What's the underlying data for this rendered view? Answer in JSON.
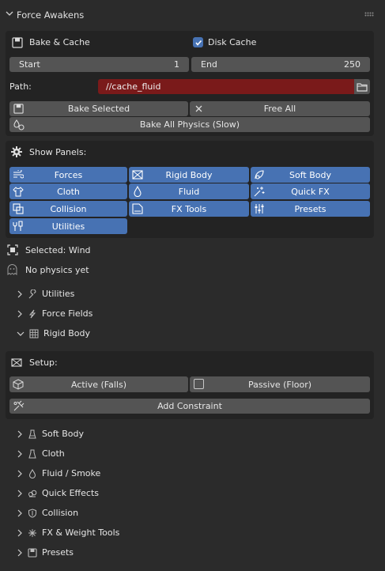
{
  "header": {
    "title": "Force Awakens"
  },
  "cache": {
    "bake_label": "Bake & Cache",
    "disk_cache_label": "Disk Cache",
    "disk_cache_checked": true,
    "start_label": "Start",
    "start_value": "1",
    "end_label": "End",
    "end_value": "250",
    "path_label": "Path:",
    "path_value": "//cache_fluid",
    "bake_selected": "Bake Selected",
    "free_all": "Free All",
    "bake_all": "Bake All Physics (Slow)"
  },
  "panels": {
    "title": "Show Panels:",
    "buttons": [
      {
        "label": "Forces",
        "icon": "wind-icon",
        "active": true
      },
      {
        "label": "Rigid Body",
        "icon": "rigid-body-icon",
        "active": true
      },
      {
        "label": "Soft Body",
        "icon": "soft-body-icon",
        "active": true
      },
      {
        "label": "Cloth",
        "icon": "cloth-icon",
        "active": true
      },
      {
        "label": "Fluid",
        "icon": "fluid-drop-icon",
        "active": true
      },
      {
        "label": "Quick FX",
        "icon": "sparkle-icon",
        "active": true
      },
      {
        "label": "Collision",
        "icon": "collision-icon",
        "active": true
      },
      {
        "label": "FX Tools",
        "icon": "fx-tools-icon",
        "active": true
      },
      {
        "label": "Presets",
        "icon": "sliders-icon",
        "active": true
      },
      {
        "label": "Utilities",
        "icon": "wrench-icon",
        "active": true
      }
    ]
  },
  "status": {
    "selected": "Selected: Wind",
    "physics": "No physics yet"
  },
  "tree": {
    "utilities": "Utilities",
    "force_fields": "Force Fields",
    "rigid_body": "Rigid Body",
    "soft_body": "Soft Body",
    "cloth": "Cloth",
    "fluid_smoke": "Fluid / Smoke",
    "quick_effects": "Quick Effects",
    "collision": "Collision",
    "fx_weight": "FX & Weight Tools",
    "presets": "Presets"
  },
  "rigid": {
    "setup_label": "Setup:",
    "active": "Active (Falls)",
    "passive": "Passive (Floor)",
    "add_constraint": "Add Constraint"
  },
  "colors": {
    "accent": "#4772b3",
    "path_bg": "#7a1a1a",
    "panel_bg": "#2b2b2b",
    "box_bg": "#232323",
    "button_bg": "#545454"
  }
}
